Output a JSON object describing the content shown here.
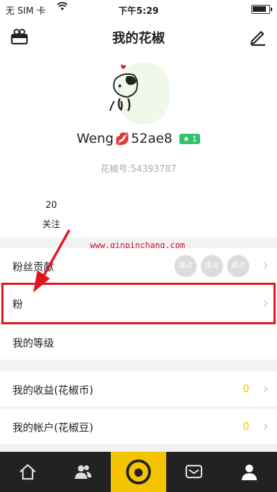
{
  "status_bar": {
    "carrier": "无 SIM 卡",
    "time": "下午5:29",
    "battery_level": 0.85
  },
  "nav": {
    "title": "我的花椒",
    "left_icon": "gift-box-icon",
    "right_icon": "edit-pencil-icon"
  },
  "profile": {
    "username_prefix": "Weng",
    "username_suffix": "52ae8",
    "lips_icon": "💋",
    "level_star": "★",
    "level": "1",
    "id_line": "花椒号:54393787",
    "follow_count": "20",
    "follow_label": "关注"
  },
  "watermark": "www.qinpinchang.com",
  "list": {
    "fan_contribution": {
      "label": "粉丝贡献",
      "badges": [
        "虚占",
        "虚占",
        "虚占"
      ]
    },
    "fan_group": {
      "label": "粉"
    },
    "my_level": {
      "label": "我的等级"
    },
    "earnings": {
      "label": "我的收益(花椒币)",
      "value": "0"
    },
    "account": {
      "label": "我的帐户(花椒豆)",
      "value": "0"
    }
  },
  "tabs": [
    "home-icon",
    "friends-icon",
    "live-camera-icon",
    "messages-icon",
    "profile-icon"
  ],
  "colors": {
    "accent": "#f5c400",
    "highlight": "#e0141c",
    "level_badge": "#2fc46a",
    "tab_bg": "#222222"
  }
}
